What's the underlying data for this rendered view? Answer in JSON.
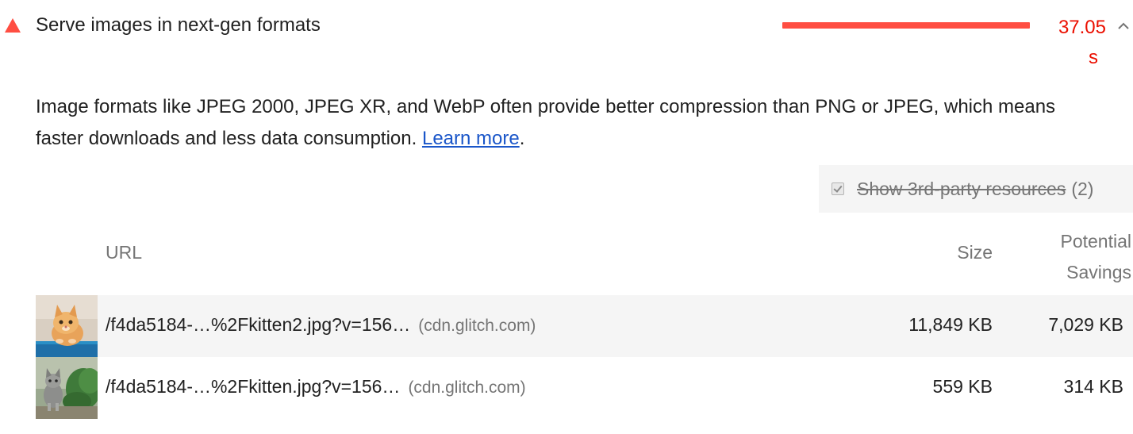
{
  "audit": {
    "title": "Serve images in next-gen formats",
    "savings_value": "37.05",
    "savings_unit": "s",
    "status": "fail",
    "status_color": "#ff4e42",
    "description_text": "Image formats like JPEG 2000, JPEG XR, and WebP often provide better compression than PNG or JPEG, which means faster downloads and less data consumption. ",
    "learn_more_label": "Learn more",
    "description_end": "."
  },
  "third_party_filter": {
    "label": "Show 3rd-party resources",
    "count": "(2)",
    "checked": true
  },
  "table": {
    "headers": {
      "url": "URL",
      "size": "Size",
      "savings": "Potential Savings"
    },
    "rows": [
      {
        "url": "/f4da5184-…%2Fkitten2.jpg?v=156…",
        "origin": "(cdn.glitch.com)",
        "size": "11,849 KB",
        "savings": "7,029 KB",
        "thumbnail": "orange-kitten-icon"
      },
      {
        "url": "/f4da5184-…%2Fkitten.jpg?v=156…",
        "origin": "(cdn.glitch.com)",
        "size": "559 KB",
        "savings": "314 KB",
        "thumbnail": "gray-kitten-icon"
      }
    ]
  }
}
